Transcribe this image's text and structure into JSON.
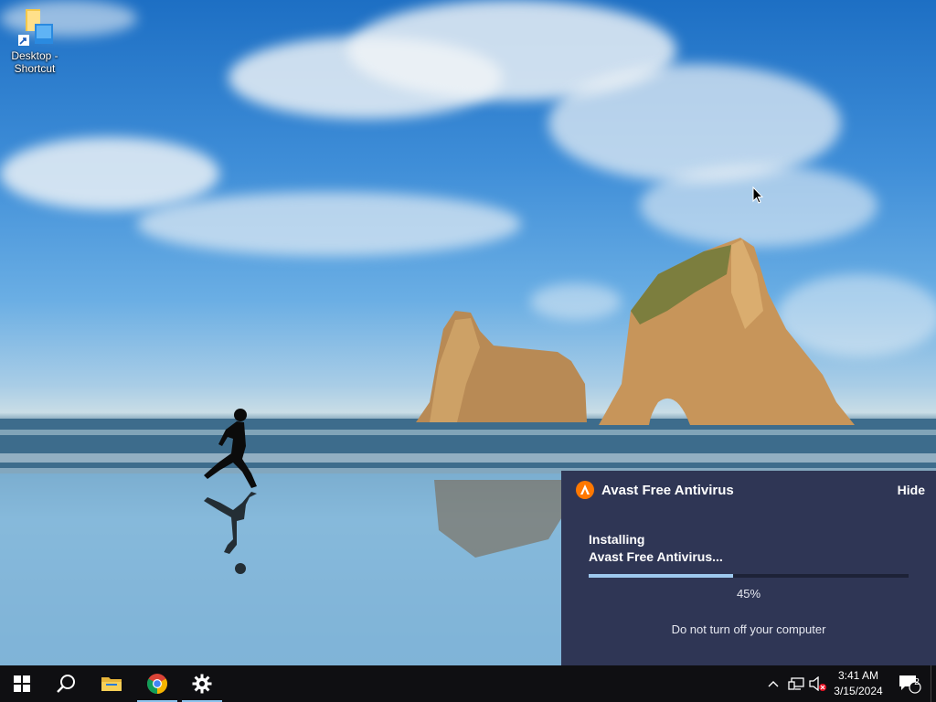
{
  "desktop": {
    "icons": [
      {
        "label": "Desktop - Shortcut",
        "icon": "folder-shortcut-icon"
      }
    ],
    "wallpaper": "beach-with-rock-arches-and-runner"
  },
  "notification": {
    "app_name": "Avast Free Antivirus",
    "hide_label": "Hide",
    "status_line1": "Installing",
    "status_line2": "Avast Free Antivirus...",
    "progress_percent": 45,
    "progress_text": "45%",
    "warning": "Do not turn off your computer",
    "accent_color": "#ff7800",
    "background_color": "#2f3655"
  },
  "taskbar": {
    "pinned": [
      {
        "name": "start",
        "icon": "windows-logo-icon"
      },
      {
        "name": "search",
        "icon": "search-icon"
      },
      {
        "name": "file-explorer",
        "icon": "folder-icon"
      },
      {
        "name": "chrome",
        "icon": "chrome-icon",
        "running": true
      },
      {
        "name": "settings",
        "icon": "gear-icon",
        "running": true
      }
    ],
    "tray": {
      "icons": [
        "chevron-up-icon",
        "network-icon",
        "volume-muted-icon"
      ],
      "time": "3:41 AM",
      "date": "3/15/2024",
      "notification_count": "2"
    }
  }
}
